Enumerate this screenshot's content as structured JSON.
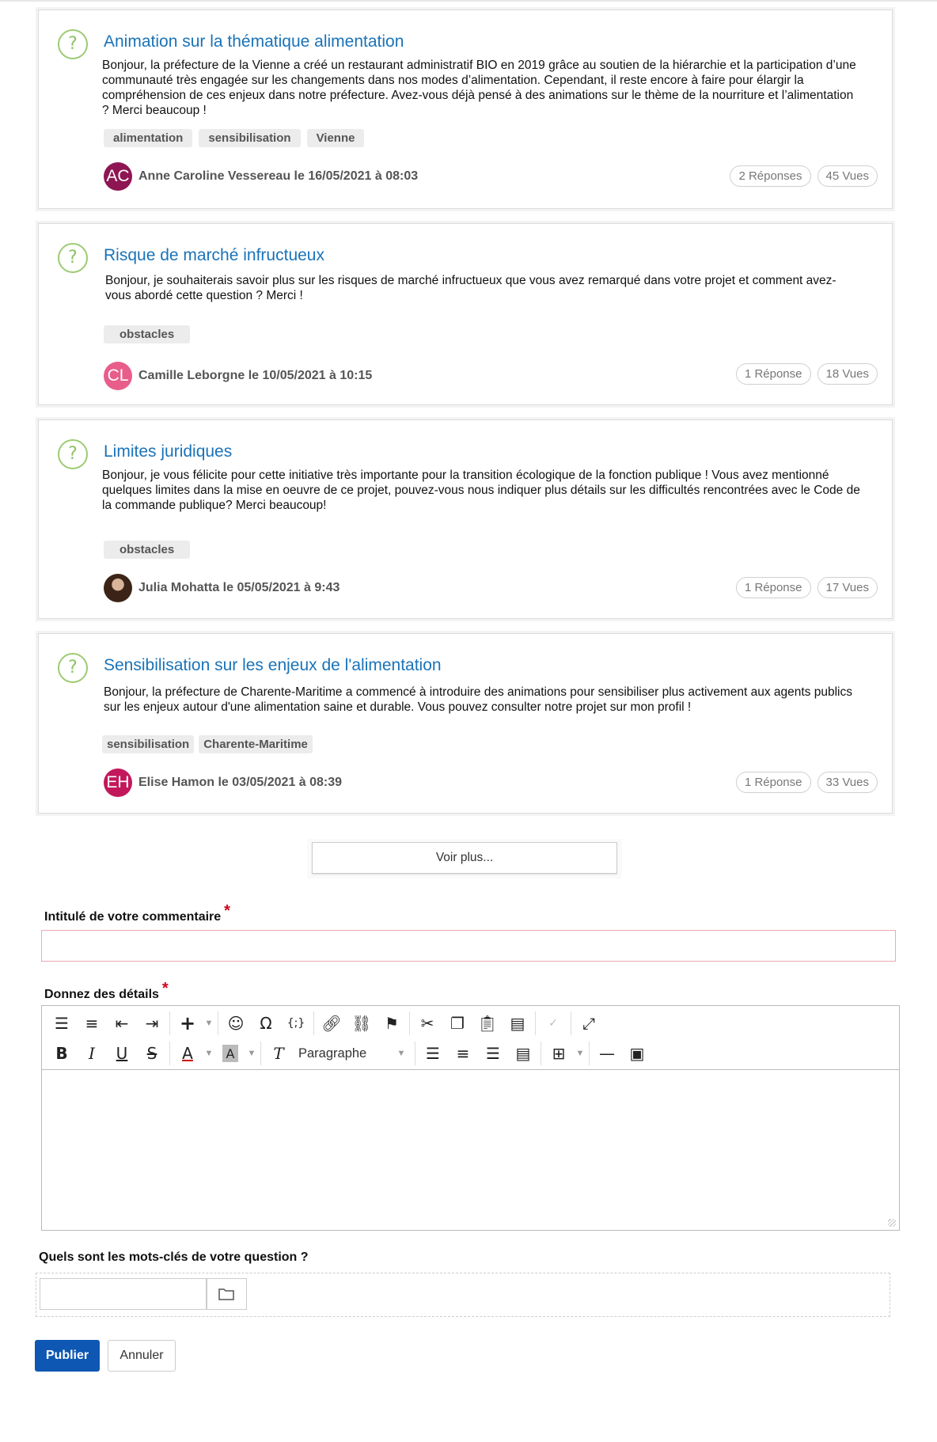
{
  "questions": [
    {
      "title": "Animation sur la thématique alimentation",
      "body": "Bonjour, la préfecture de la Vienne a créé un restaurant administratif BIO en 2019 grâce au soutien de la hiérarchie et la participation d’une communauté très engagée sur les changements dans nos modes d’alimentation. Cependant, il reste encore à faire pour élargir la compréhension de ces enjeux dans notre préfecture. Avez-vous déjà pensé à des animations sur le thème de la nourriture et l’alimentation ? Merci beaucoup !",
      "tags": [
        "alimentation",
        "sensibilisation",
        "Vienne"
      ],
      "initials": "AC",
      "avatar_color": "#8e1653",
      "author": "Anne Caroline Vessereau le 16/05/2021 à 08:03",
      "replies": "2 Réponses",
      "views": "45 Vues"
    },
    {
      "title": "Risque de marché infructueux",
      "body": "Bonjour, je souhaiterais savoir plus sur les risques de marché infructueux que vous avez remarqué dans votre projet et comment avez-vous abordé cette question ? Merci !",
      "tags": [
        "obstacles"
      ],
      "initials": "CL",
      "avatar_color": "#e85d8a",
      "author": "Camille Leborgne le 10/05/2021 à 10:15",
      "replies": "1 Réponse",
      "views": "18 Vues"
    },
    {
      "title": "Limites juridiques",
      "body": "Bonjour, je vous félicite pour cette initiative très importante pour la transition écologique de la fonction publique ! Vous avez mentionné quelques limites dans la mise en oeuvre de ce projet, pouvez-vous nous indiquer plus détails sur les difficultés rencontrées avec le Code de la commande publique? Merci beaucoup!",
      "tags": [
        "obstacles"
      ],
      "initials": "",
      "avatar_color": "#5a3a2e",
      "author": "Julia Mohatta le 05/05/2021 à 9:43",
      "replies": "1 Réponse",
      "views": "17 Vues"
    },
    {
      "title": "Sensibilisation sur les enjeux de l'alimentation",
      "body": "Bonjour, la préfecture de Charente-Maritime a commencé à introduire des animations pour sensibiliser plus activement aux agents publics sur les enjeux autour d'une alimentation saine et durable. Vous pouvez consulter notre projet sur mon profil !",
      "tags": [
        "sensibilisation",
        "Charente-Maritime"
      ],
      "initials": "EH",
      "avatar_color": "#c2185b",
      "author": "Elise Hamon le 03/05/2021 à 08:39",
      "replies": "1 Réponse",
      "views": "33 Vues"
    }
  ],
  "more_label": "Voir plus...",
  "form": {
    "title_label": "Intitulé de votre commentaire",
    "details_label": "Donnez des détails",
    "required_mark": "*",
    "keywords_label": "Quels sont les mots-clés de votre question ?",
    "paragraph_option": "Paragraphe",
    "publish_label": "Publier",
    "cancel_label": "Annuler"
  }
}
